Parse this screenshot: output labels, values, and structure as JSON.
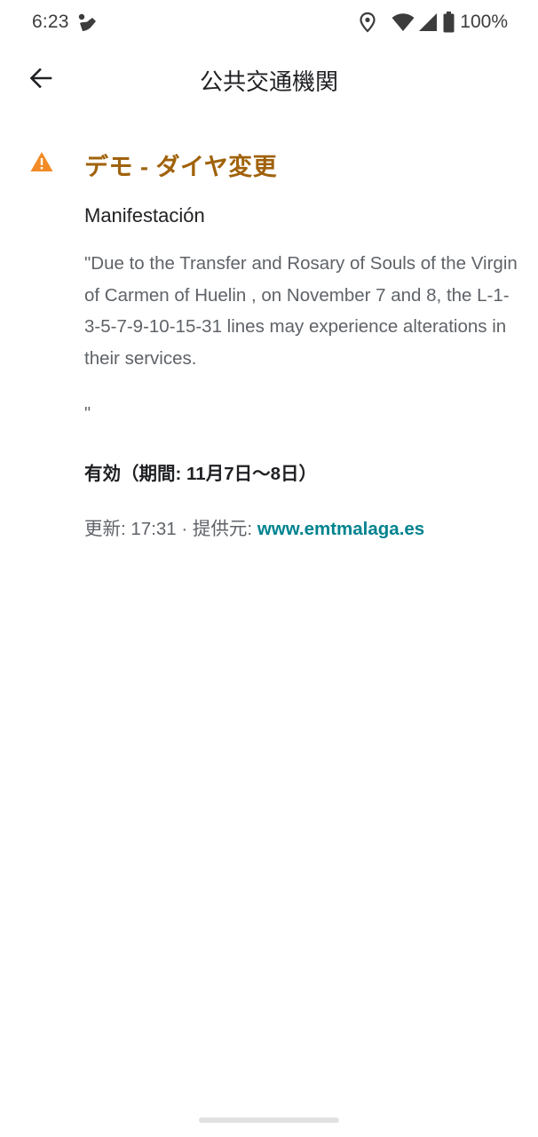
{
  "status_bar": {
    "time": "6:23",
    "battery": "100%",
    "icons": [
      "phone-call-app-icon",
      "location-icon",
      "wifi-icon",
      "cell-signal-icon",
      "battery-icon"
    ]
  },
  "app_bar": {
    "title": "公共交通機関",
    "back_icon": "arrow-back-icon"
  },
  "alert": {
    "icon": "warning-icon",
    "icon_color": "#f28b27",
    "title": "デモ - ダイヤ変更",
    "title_color": "#a0620b",
    "subtitle": "Manifestación",
    "body": "\"Due to the Transfer and Rosary of Souls of the Virgin of Carmen of Huelin , on November 7 and 8, the L-1-3-5-7-9-10-15-31 lines may experience alterations in their services.",
    "body_tail": "\"",
    "validity": "有効（期間: 11月7日〜8日）",
    "updated_prefix": "更新: 17:31 · 提供元: ",
    "provider_link": "www.emtmalaga.es",
    "link_color": "#00838f"
  }
}
